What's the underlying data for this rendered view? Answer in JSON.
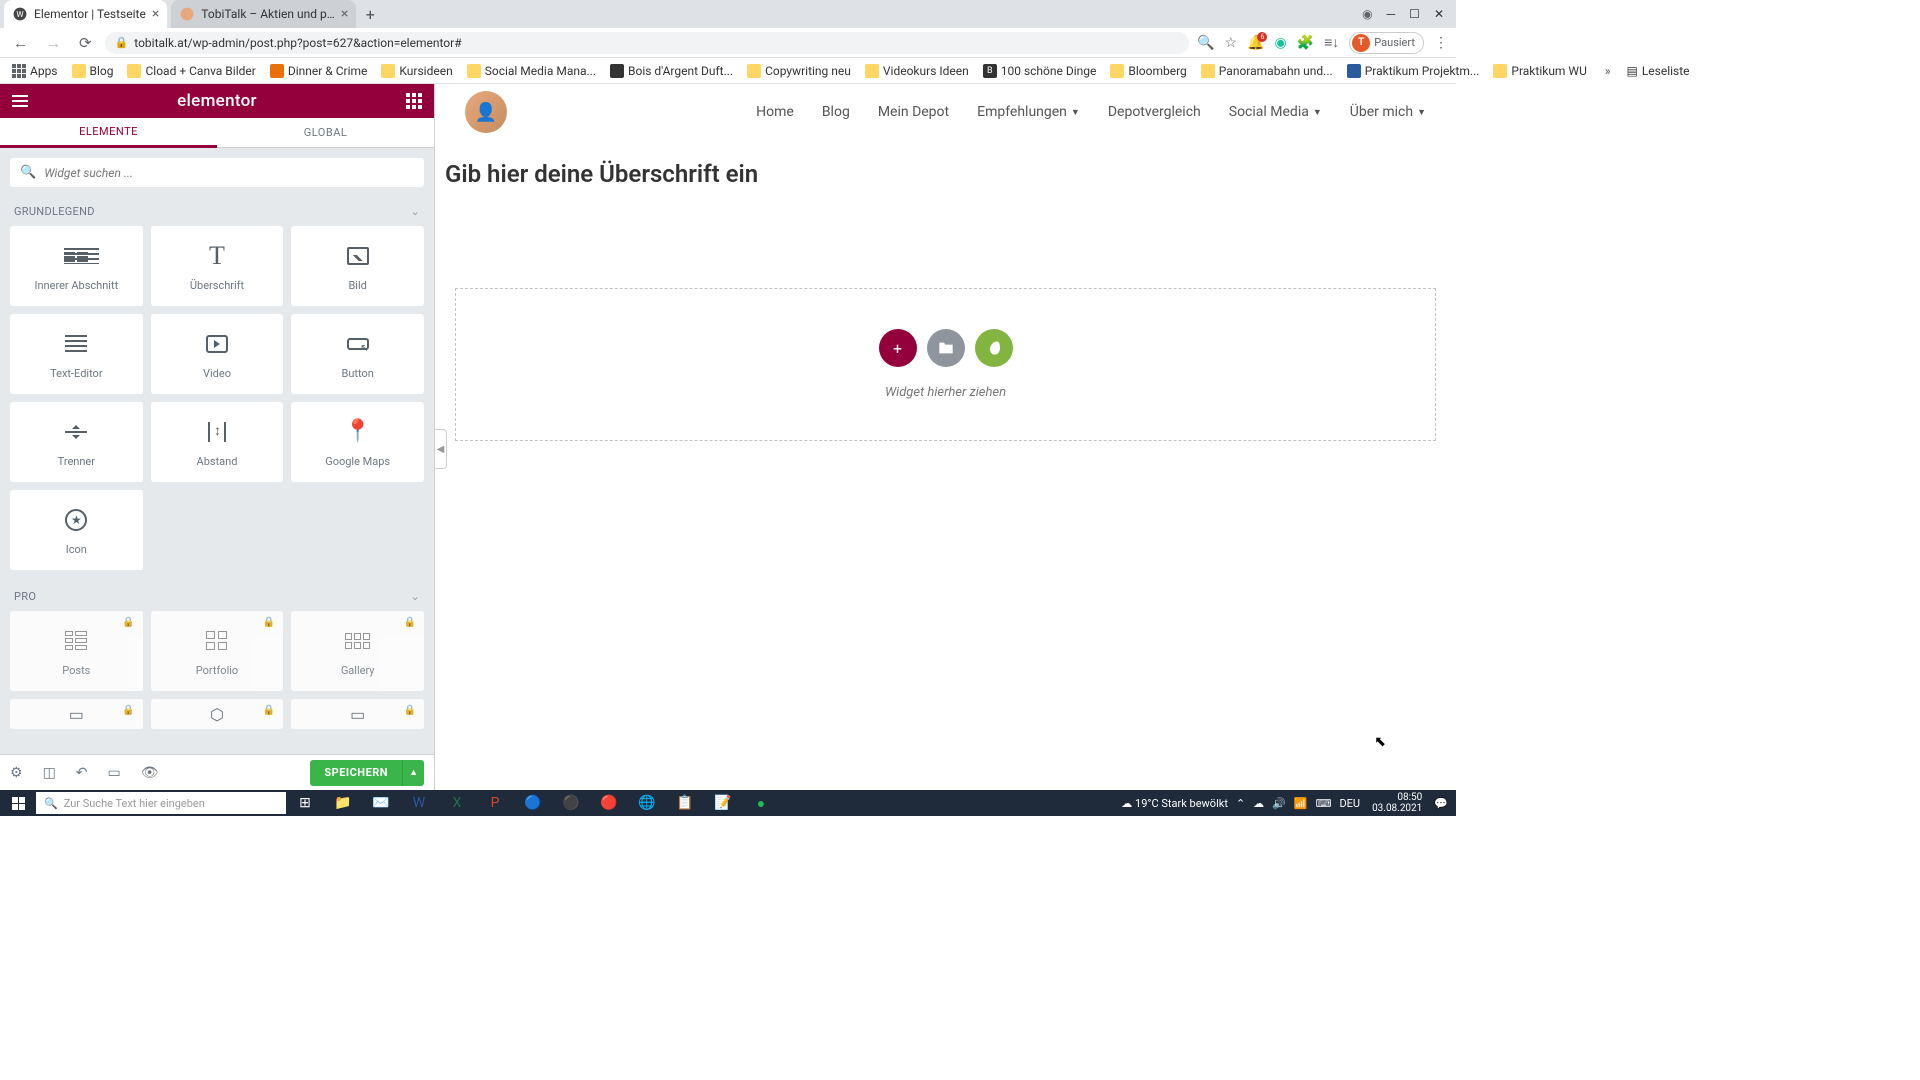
{
  "browser": {
    "tabs": [
      {
        "title": "Elementor | Testseite",
        "active": true
      },
      {
        "title": "TobiTalk – Aktien und persönliche...",
        "active": false
      }
    ],
    "url": "tobitalk.at/wp-admin/post.php?post=627&action=elementor#",
    "profile_status": "Pausiert",
    "profile_initial": "T",
    "account_dot_color": "#1a73e8",
    "window_controls": {
      "min": "─",
      "max": "☐",
      "close": "✕"
    }
  },
  "bookmarks": {
    "apps_label": "Apps",
    "items": [
      "Blog",
      "Cload + Canva Bilder",
      "Dinner & Crime",
      "Kursideen",
      "Social Media Mana...",
      "Bois d'Argent Duft...",
      "Copywriting neu",
      "Videokurs Ideen",
      "100 schöne Dinge",
      "Bloomberg",
      "Panoramabahn und...",
      "Praktikum Projektm...",
      "Praktikum WU"
    ],
    "more": "»",
    "readlist": "Leseliste"
  },
  "elementor": {
    "logo": "elementor",
    "tabs": {
      "elements": "ELEMENTE",
      "global": "GLOBAL"
    },
    "search_placeholder": "Widget suchen ...",
    "categories": {
      "basic": "GRUNDLEGEND",
      "pro": "PRO"
    },
    "widgets_basic": [
      {
        "id": "inner-section",
        "label": "Innerer Abschnitt",
        "icon": "lines"
      },
      {
        "id": "heading",
        "label": "Überschrift",
        "icon": "T"
      },
      {
        "id": "image",
        "label": "Bild",
        "icon": "img"
      },
      {
        "id": "text-editor",
        "label": "Text-Editor",
        "icon": "lines"
      },
      {
        "id": "video",
        "label": "Video",
        "icon": "play"
      },
      {
        "id": "button",
        "label": "Button",
        "icon": "btn"
      },
      {
        "id": "divider",
        "label": "Trenner",
        "icon": "div"
      },
      {
        "id": "spacer",
        "label": "Abstand",
        "icon": "spacer"
      },
      {
        "id": "google-maps",
        "label": "Google Maps",
        "icon": "map"
      },
      {
        "id": "icon",
        "label": "Icon",
        "icon": "star"
      }
    ],
    "widgets_pro": [
      {
        "id": "posts",
        "label": "Posts",
        "icon": "posts"
      },
      {
        "id": "portfolio",
        "label": "Portfolio",
        "icon": "grid4"
      },
      {
        "id": "gallery",
        "label": "Gallery",
        "icon": "gallery"
      }
    ],
    "footer": {
      "save": "SPEICHERN"
    }
  },
  "canvas": {
    "nav": [
      {
        "label": "Home",
        "dropdown": false
      },
      {
        "label": "Blog",
        "dropdown": false
      },
      {
        "label": "Mein Depot",
        "dropdown": false
      },
      {
        "label": "Empfehlungen",
        "dropdown": true
      },
      {
        "label": "Depotvergleich",
        "dropdown": false
      },
      {
        "label": "Social Media",
        "dropdown": true
      },
      {
        "label": "Über mich",
        "dropdown": true
      }
    ],
    "heading_placeholder": "Gib hier deine Überschrift ein",
    "drop_label": "Widget hierher ziehen"
  },
  "taskbar": {
    "search_placeholder": "Zur Suche Text hier eingeben",
    "weather_temp": "19°C",
    "weather_text": "Stark bewölkt",
    "lang": "DEU",
    "time": "08:50",
    "date": "03.08.2021"
  }
}
